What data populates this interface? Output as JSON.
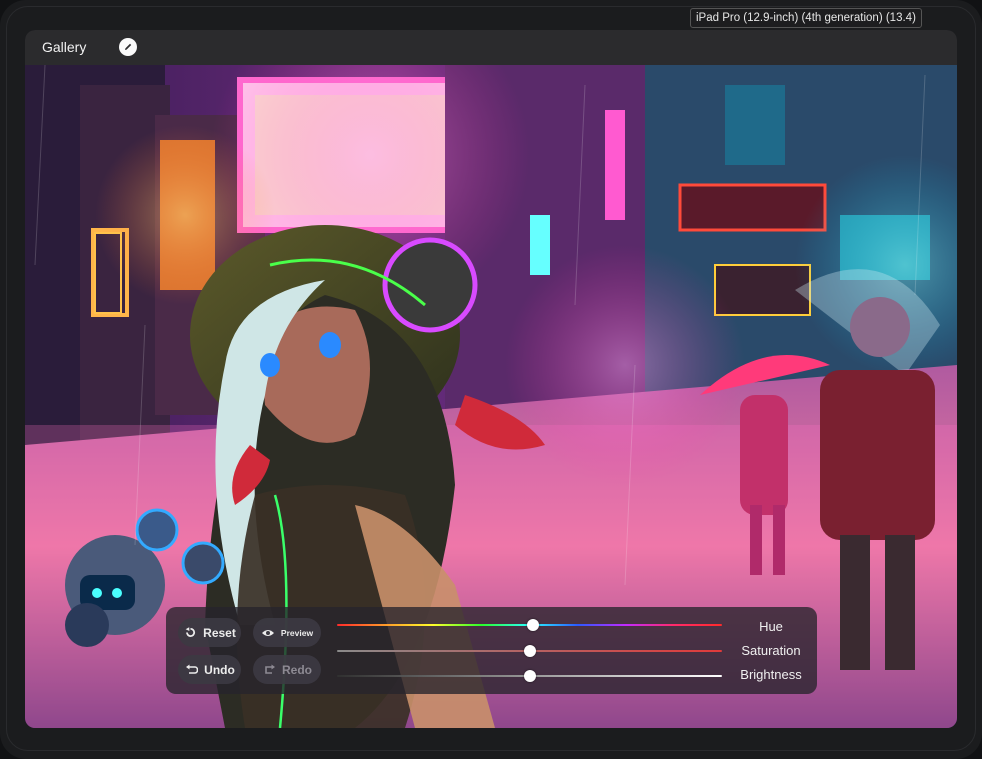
{
  "simulator": {
    "device_label": "iPad Pro (12.9-inch) (4th generation) (13.4)"
  },
  "topbar": {
    "gallery_label": "Gallery",
    "edit_icon": "pencil-icon"
  },
  "artwork": {
    "description_icon": "image"
  },
  "controls": {
    "reset_label": "Reset",
    "preview_label": "Preview",
    "undo_label": "Undo",
    "redo_label": "Redo",
    "sliders": [
      {
        "label": "Hue",
        "value": 0.51
      },
      {
        "label": "Saturation",
        "value": 0.5
      },
      {
        "label": "Brightness",
        "value": 0.5
      }
    ]
  },
  "colors": {
    "accent": "#ff2fa8",
    "panel": "#2b2b2d"
  }
}
